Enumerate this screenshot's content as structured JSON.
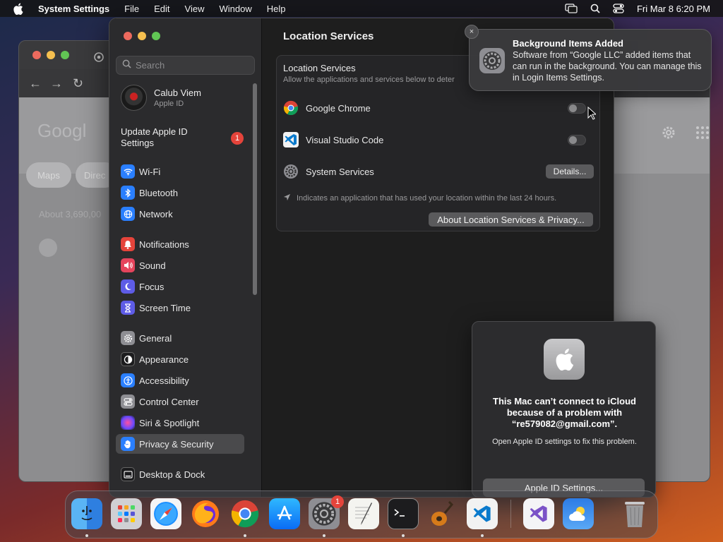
{
  "menubar": {
    "app": "System Settings",
    "items": [
      "File",
      "Edit",
      "View",
      "Window",
      "Help"
    ],
    "datetime": "Fri Mar 8  6:20 PM"
  },
  "browser": {
    "ghost": {
      "pill_maps": "Maps",
      "pill_directions": "Direc",
      "result_count": "About 3,690,00"
    }
  },
  "settings": {
    "search_placeholder": "Search",
    "profile": {
      "name": "Calub Viem",
      "sub": "Apple ID"
    },
    "update": {
      "label": "Update Apple ID Settings",
      "badge": "1"
    },
    "sidebar": [
      {
        "label": "Wi-Fi",
        "icon": "wifi-icon",
        "color": "#2a7fff"
      },
      {
        "label": "Bluetooth",
        "icon": "bluetooth-icon",
        "color": "#2a7fff"
      },
      {
        "label": "Network",
        "icon": "globe-icon",
        "color": "#2a7fff"
      },
      {
        "label": "Notifications",
        "icon": "bell-icon",
        "color": "#e5443b"
      },
      {
        "label": "Sound",
        "icon": "speaker-icon",
        "color": "#e5445c"
      },
      {
        "label": "Focus",
        "icon": "moon-icon",
        "color": "#5e5ce6"
      },
      {
        "label": "Screen Time",
        "icon": "hourglass-icon",
        "color": "#5e5ce6"
      },
      {
        "label": "General",
        "icon": "gear-icon",
        "color": "#8e8e93"
      },
      {
        "label": "Appearance",
        "icon": "appearance-icon",
        "color": "#1c1c1e"
      },
      {
        "label": "Accessibility",
        "icon": "accessibility-icon",
        "color": "#2a7fff"
      },
      {
        "label": "Control Center",
        "icon": "control-center-icon",
        "color": "#8e8e93"
      },
      {
        "label": "Siri & Spotlight",
        "icon": "siri-icon",
        "color": "#b04aff"
      },
      {
        "label": "Privacy & Security",
        "icon": "hand-icon",
        "color": "#2a7fff"
      },
      {
        "label": "Desktop & Dock",
        "icon": "dock-icon",
        "color": "#1c1c1e"
      }
    ],
    "main": {
      "title": "Location Services",
      "panel_heading": "Location Services",
      "panel_desc": "Allow the applications and services below to deter",
      "apps": [
        {
          "label": "Google Chrome",
          "icon": "chrome-icon"
        },
        {
          "label": "Visual Studio Code",
          "icon": "vscode-icon"
        },
        {
          "label": "System Services",
          "icon": "gear-icon"
        }
      ],
      "details_button": "Details...",
      "hint": "Indicates an application that has used your location within the last 24 hours.",
      "about_button": "About Location Services & Privacy..."
    }
  },
  "notification": {
    "title": "Background Items Added",
    "body": "Software from “Google LLC” added items that can run in the background. You can manage this in Login Items Settings.",
    "close": "×"
  },
  "alert": {
    "title": "This Mac can’t connect to iCloud because of a problem with “re579082@gmail.com”.",
    "body": "Open Apple ID settings to fix this problem.",
    "button": "Apple ID Settings..."
  },
  "dock": {
    "apps": [
      "Finder",
      "Launchpad",
      "Safari",
      "Firefox",
      "Google Chrome",
      "App Store",
      "System Settings",
      "TextEdit",
      "Terminal",
      "GarageBand",
      "Visual Studio Code",
      "Visual Studio",
      "Weather",
      "Trash"
    ],
    "settings_badge": "1"
  },
  "colors": {
    "accent": "#2a7fff",
    "badge": "#e5443b"
  }
}
